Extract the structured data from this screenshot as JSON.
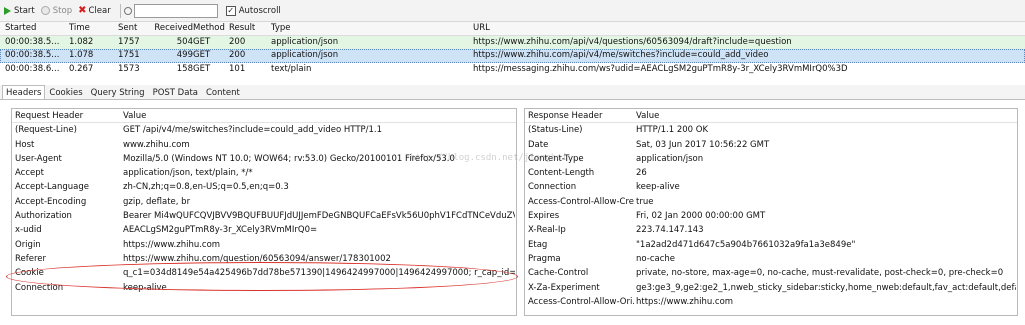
{
  "toolbar": {
    "start_label": "Start",
    "stop_label": "Stop",
    "clear_label": "Clear",
    "find_value": "",
    "autoscroll_label": "Autoscroll",
    "autoscroll_checked": "✓"
  },
  "grid": {
    "columns": [
      "Started",
      "Time",
      "Sent",
      "Received",
      "Method",
      "Result",
      "Type",
      "URL"
    ],
    "rows": [
      {
        "started": "00:00:38.5...",
        "time": "1.082",
        "sent": "1757",
        "received": "504",
        "method": "GET",
        "result": "200",
        "type": "application/json",
        "url": "https://www.zhihu.com/api/v4/questions/60563094/draft?include=question"
      },
      {
        "started": "00:00:38.5...",
        "time": "1.078",
        "sent": "1751",
        "received": "499",
        "method": "GET",
        "result": "200",
        "type": "application/json",
        "url": "https://www.zhihu.com/api/v4/me/switches?include=could_add_video"
      },
      {
        "started": "00:00:38.6...",
        "time": "0.267",
        "sent": "1573",
        "received": "158",
        "method": "GET",
        "result": "101",
        "type": "text/plain",
        "url": "https://messaging.zhihu.com/ws?udid=AEACLgSM2guPTmR8y-3r_XCely3RVmMIrQ0%3D"
      }
    ]
  },
  "tabs": [
    "Headers",
    "Cookies",
    "Query String",
    "POST Data",
    "Content"
  ],
  "request_headers": {
    "header_col": "Request Header",
    "value_col": "Value",
    "rows": [
      {
        "k": "(Request-Line)",
        "v": "GET /api/v4/me/switches?include=could_add_video HTTP/1.1"
      },
      {
        "k": "Host",
        "v": "www.zhihu.com"
      },
      {
        "k": "User-Agent",
        "v": "Mozilla/5.0 (Windows NT 10.0; WOW64; rv:53.0) Gecko/20100101 Firefox/53.0"
      },
      {
        "k": "Accept",
        "v": "application/json, text/plain, */*"
      },
      {
        "k": "Accept-Language",
        "v": "zh-CN,zh;q=0.8,en-US;q=0.5,en;q=0.3"
      },
      {
        "k": "Accept-Encoding",
        "v": "gzip, deflate, br"
      },
      {
        "k": "Authorization",
        "v": "Bearer Mi4wQUFCQVJBVV9BQUFBUUFJdUJJemFDeGNBQUFCaEFsVk56U0phV1FCdTNCeVduZVZ3X0h..."
      },
      {
        "k": "x-udid",
        "v": "AEACLgSM2guPTmR8y-3r_XCely3RVmMIrQ0="
      },
      {
        "k": "Origin",
        "v": "https://www.zhihu.com"
      },
      {
        "k": "Referer",
        "v": "https://www.zhihu.com/question/60563094/answer/178301002"
      },
      {
        "k": "Cookie",
        "v": "q_c1=034d8149e54a425496b7dd78be571390|1496424997000|1496424997000; r_cap_id=\"ZDE4MTg2..."
      },
      {
        "k": "Connection",
        "v": "keep-alive"
      }
    ]
  },
  "response_headers": {
    "header_col": "Response Header",
    "value_col": "Value",
    "rows": [
      {
        "k": "(Status-Line)",
        "v": "HTTP/1.1 200 OK"
      },
      {
        "k": "Date",
        "v": "Sat, 03 Jun 2017 10:56:22 GMT"
      },
      {
        "k": "Content-Type",
        "v": "application/json"
      },
      {
        "k": "Content-Length",
        "v": "26"
      },
      {
        "k": "Connection",
        "v": "keep-alive"
      },
      {
        "k": "Access-Control-Allow-Cre...",
        "v": "true"
      },
      {
        "k": "Expires",
        "v": "Fri, 02 Jan 2000 00:00:00 GMT"
      },
      {
        "k": "X-Real-Ip",
        "v": "223.74.147.143"
      },
      {
        "k": "Etag",
        "v": "\"1a2ad2d471d647c5a904b7661032a9fa1a3e849e\""
      },
      {
        "k": "Pragma",
        "v": "no-cache"
      },
      {
        "k": "Cache-Control",
        "v": "private, no-store, max-age=0, no-cache, must-revalidate, post-check=0, pre-check=0"
      },
      {
        "k": "X-Za-Experiment",
        "v": "ge3:ge3_9,ge2:ge2_1,nweb_sticky_sidebar:sticky,home_nweb:default,fav_act:default,default:None,new_..."
      },
      {
        "k": "Access-Control-Allow-Ori...",
        "v": "https://www.zhihu.com"
      }
    ]
  },
  "watermark": "http://blog.csdn.net/jionghai...",
  "colors": {
    "selected_row": "#cfe3f7",
    "first_row": "#e3f6e3",
    "annotation": "#d9342b"
  }
}
